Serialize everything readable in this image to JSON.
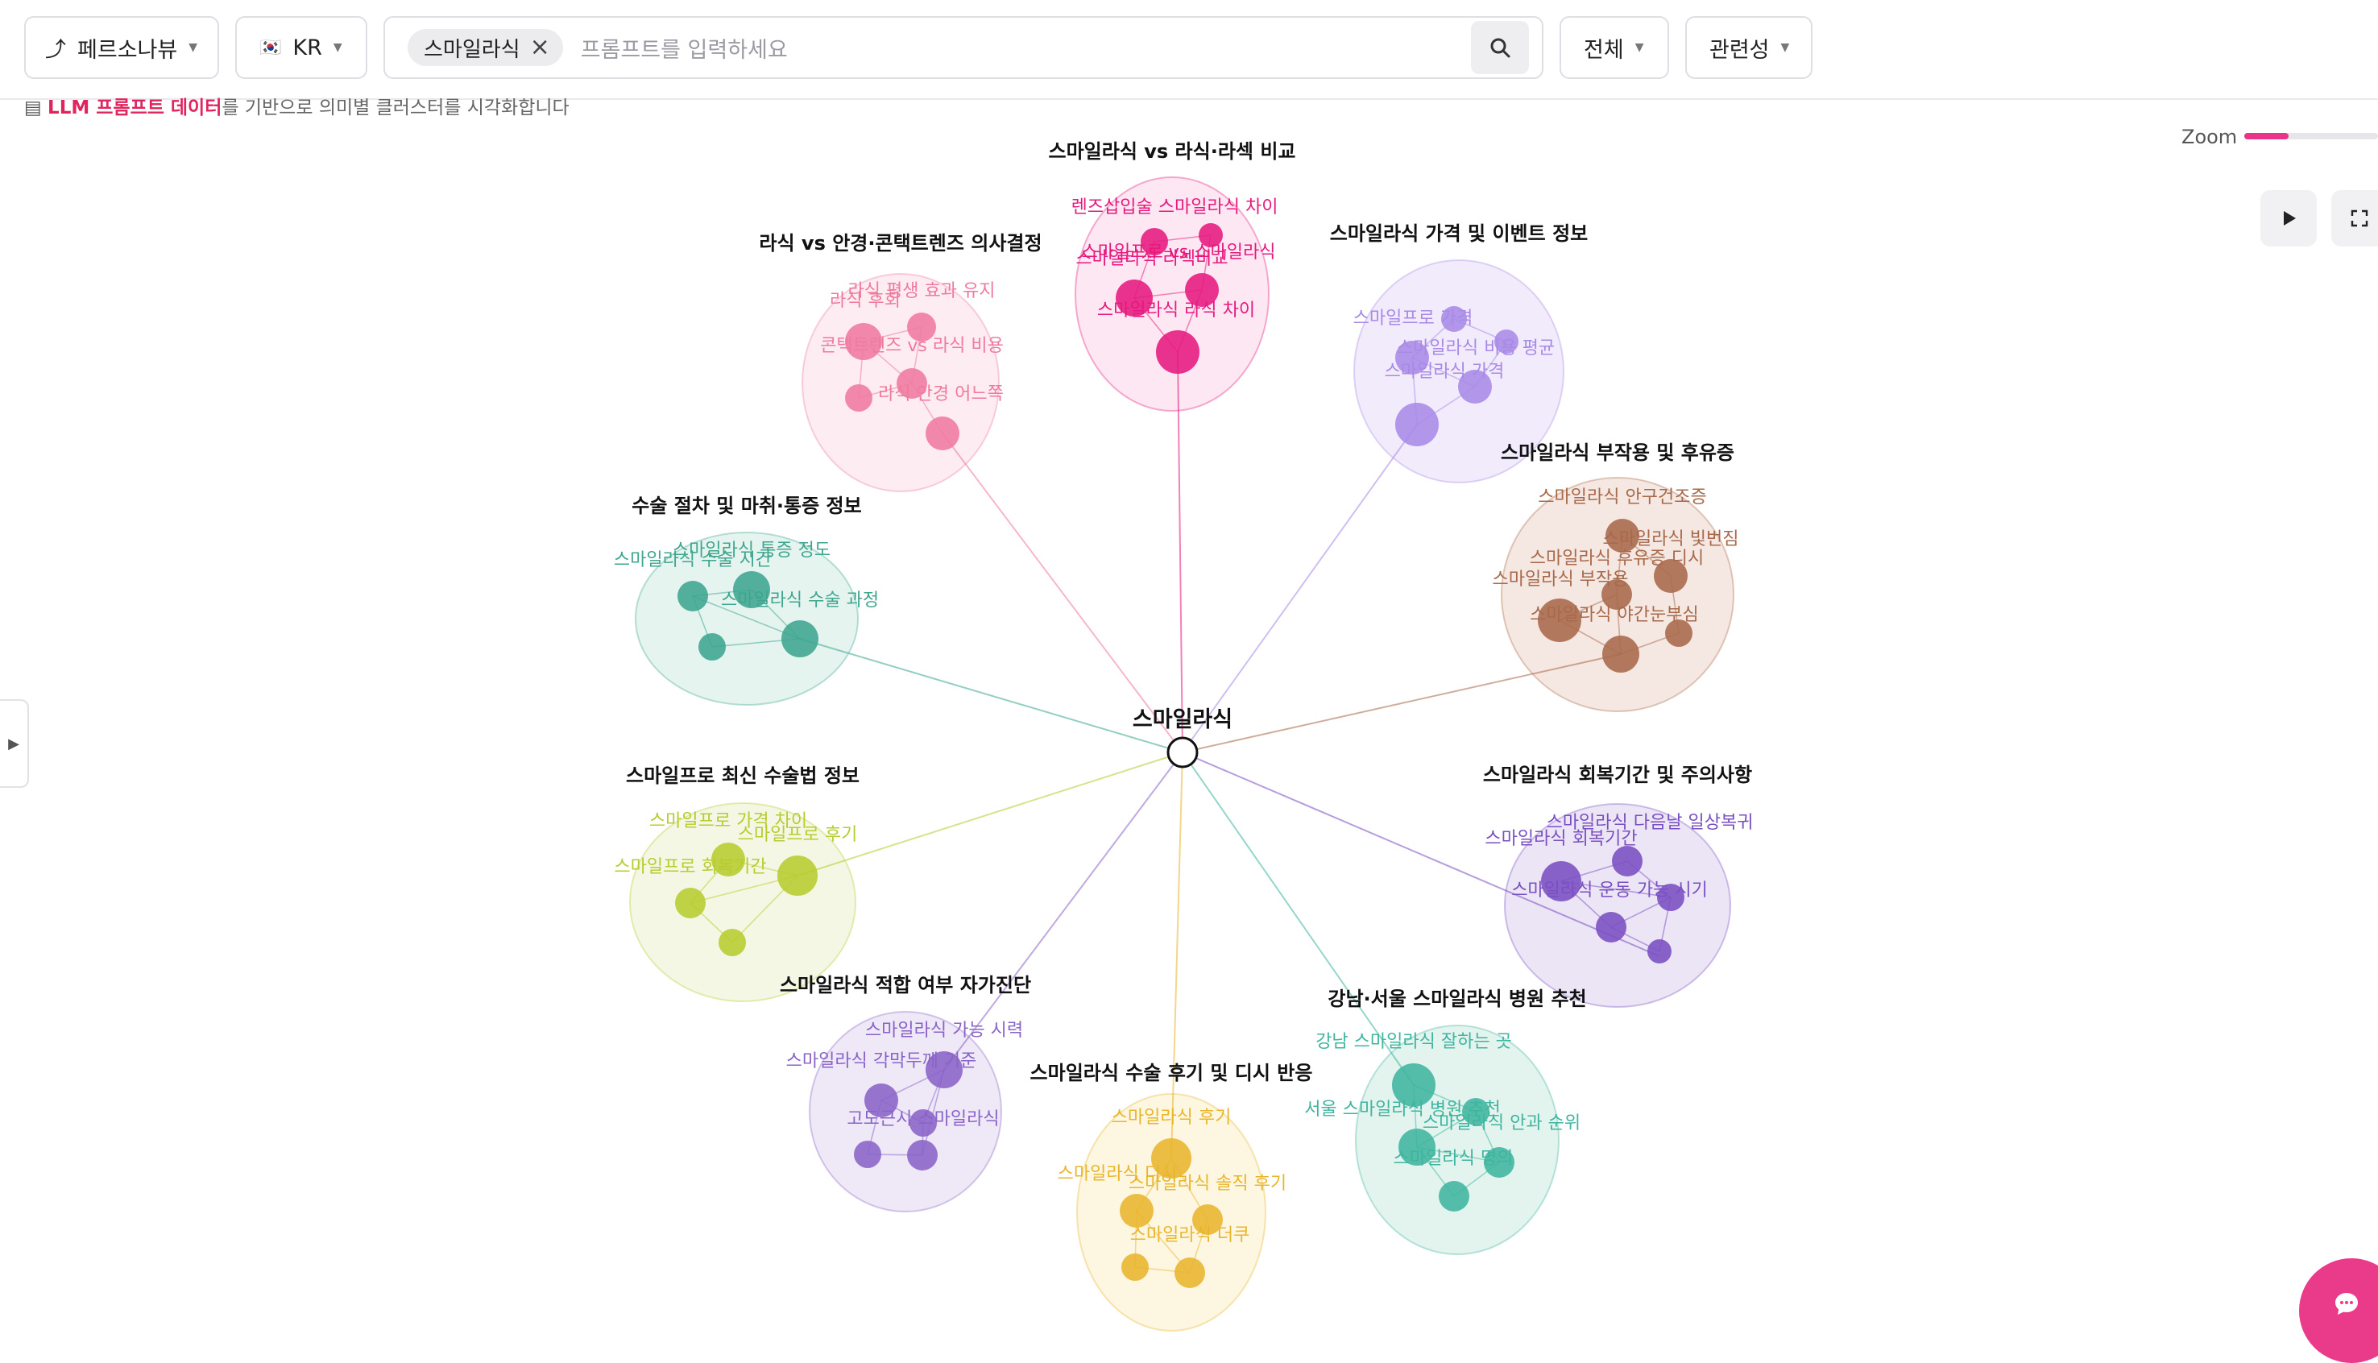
{
  "toolbar": {
    "persona_label": "페르소나뷰",
    "country_flag": "🇰🇷",
    "country_label": "KR",
    "chip_label": "스마일라식",
    "search_placeholder": "프롬프트를 입력하세요",
    "filter_label": "전체",
    "sort_label": "관련성"
  },
  "subtitle": {
    "highlight": "LLM 프롬프트 데이터",
    "rest": "를 기반으로 의미별 클러스터를 시각화합니다"
  },
  "zoom": {
    "label": "Zoom",
    "level": 0.33
  },
  "center": {
    "label": "스마일라식"
  },
  "clusters": [
    {
      "title": "스마일라식 vs 라식·라섹 비교",
      "color": "#e6197e",
      "fill": "#fde3f0",
      "nodes": [
        "렌즈삽입술 스마일라식 차이",
        "스마일프로 vs 스마일라식",
        "스마일라식 라섹비교",
        "스마일라식 라식 차이"
      ]
    },
    {
      "title": "라식 vs 안경·콘택트렌즈 의사결정",
      "color": "#ef7aa0",
      "fill": "#fde9ef",
      "nodes": [
        "라식 평생 효과 유지",
        "라식 후회",
        "콘택트렌즈 vs 라식 비용",
        "라식 안경 어느쪽"
      ]
    },
    {
      "title": "스마일라식 가격 및 이벤트 정보",
      "color": "#a88ae6",
      "fill": "#efe8fb",
      "nodes": [
        "스마일프로 가격",
        "스마일라식 비용 평균",
        "스마일라식 가격"
      ]
    },
    {
      "title": "스마일라식 부작용 및 후유증",
      "color": "#a8694a",
      "fill": "#f3e3dc",
      "nodes": [
        "스마일라식 안구건조증",
        "스마일라식 빛번짐",
        "스마일라식 후유증 디시",
        "스마일라식 부작용",
        "스마일라식 야간눈부심"
      ]
    },
    {
      "title": "수술 절차 및 마취·통증 정보",
      "color": "#3ea58f",
      "fill": "#e1f2ec",
      "nodes": [
        "스마일라식 통증 정도",
        "스마일라식 수술 시간",
        "스마일라식 수술 과정"
      ]
    },
    {
      "title": "스마일프로 최신 수술법 정보",
      "color": "#b7cc2e",
      "fill": "#f2f6de",
      "nodes": [
        "스마일프로 가격 차이",
        "스마일프로 후기",
        "스마일프로 회복기간"
      ]
    },
    {
      "title": "스마일라식 회복기간 및 주의사항",
      "color": "#7a4fc2",
      "fill": "#e8e1f4",
      "nodes": [
        "스마일라식 다음날 일상복귀",
        "스마일라식 회복기간",
        "스마일라식 운동 가능 시기"
      ]
    },
    {
      "title": "스마일라식 적합 여부 자가진단",
      "color": "#8a63c8",
      "fill": "#ebe4f6",
      "nodes": [
        "스마일라식 가능 시력",
        "스마일라식 각막두께 기준",
        "고도근시 스마일라식"
      ]
    },
    {
      "title": "강남·서울 스마일라식 병원 추천",
      "color": "#3fb59f",
      "fill": "#def2ec",
      "nodes": [
        "강남 스마일라식 잘하는 곳",
        "서울 스마일라식 병원 추천",
        "스마일라식 안과 순위",
        "스마일라식 명의"
      ]
    },
    {
      "title": "스마일라식 수술 후기 및 디시 반응",
      "color": "#e9b52c",
      "fill": "#fdf4dc",
      "nodes": [
        "스마일라식 후기",
        "스마일라식 디시",
        "스마일라식 솔직 후기",
        "스마일라식 더쿠"
      ]
    }
  ]
}
